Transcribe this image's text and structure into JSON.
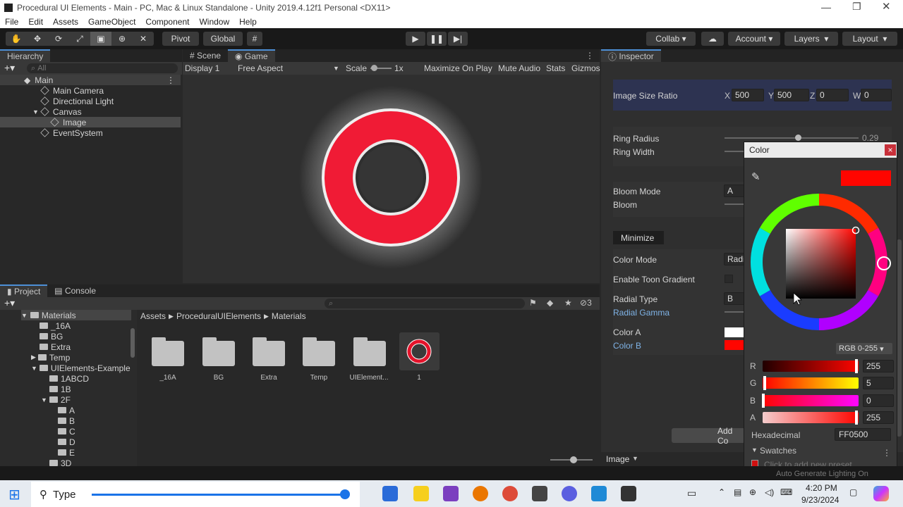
{
  "window": {
    "title": "Procedural UI Elements - Main - PC, Mac & Linux Standalone - Unity 2019.4.12f1 Personal <DX11>"
  },
  "menu": [
    "File",
    "Edit",
    "Assets",
    "GameObject",
    "Component",
    "Window",
    "Help"
  ],
  "toolbar": {
    "pivot": "Pivot",
    "global": "Global",
    "collab": "Collab",
    "account": "Account",
    "layers": "Layers",
    "layout": "Layout"
  },
  "hierarchy": {
    "tab": "Hierarchy",
    "search_placeholder": "All",
    "scene": "Main",
    "items": [
      "Main Camera",
      "Directional Light",
      "Canvas",
      "Image",
      "EventSystem"
    ]
  },
  "scene_tabs": {
    "scene": "Scene",
    "game": "Game"
  },
  "game_bar": {
    "display": "Display 1",
    "aspect": "Free Aspect",
    "scale_label": "Scale",
    "scale_value": "1x",
    "maximize": "Maximize On Play",
    "mute": "Mute Audio",
    "stats": "Stats",
    "gizmos": "Gizmos"
  },
  "project": {
    "tab": "Project",
    "console": "Console",
    "badge": "3",
    "tree": [
      "Materials",
      "_16A",
      "BG",
      "Extra",
      "Temp",
      "UIElements-Example",
      "1ABCD",
      "1B",
      "2F",
      "A",
      "B",
      "C",
      "D",
      "E",
      "3D"
    ],
    "breadcrumb": [
      "Assets",
      "ProceduralUIElements",
      "Materials"
    ],
    "assets": [
      "_16A",
      "BG",
      "Extra",
      "Temp",
      "UIElement...",
      "1"
    ]
  },
  "inspector": {
    "tab": "Inspector",
    "size_ratio_label": "Image Size Ratio",
    "size_x": "500",
    "size_y": "500",
    "size_z": "0",
    "size_w": "0",
    "ring_radius": "Ring Radius",
    "ring_radius_val": "0.29",
    "ring_width": "Ring Width",
    "bloom_mode": "Bloom Mode",
    "bloom_mode_val": "A",
    "bloom": "Bloom",
    "minimize": "Minimize",
    "color_mode": "Color Mode",
    "color_mode_val": "Radi",
    "toon": "Enable Toon Gradient",
    "radial_type": "Radial Type",
    "radial_type_val": "B",
    "radial_gamma": "Radial Gamma",
    "color_a": "Color A",
    "color_b": "Color B",
    "add_component": "Add Co",
    "footer": "Image"
  },
  "color_picker": {
    "title": "Color",
    "close": "×",
    "mode": "RGB 0-255",
    "r_label": "R",
    "r": "255",
    "g_label": "G",
    "g": "5",
    "b_label": "B",
    "b": "0",
    "a_label": "A",
    "a": "255",
    "hex_label": "Hexadecimal",
    "hex": "FF0500",
    "swatches": "Swatches",
    "swatch_hint": "Click to add new preset",
    "current_color": "#ff0500"
  },
  "taskbar": {
    "search": "Type",
    "time": "4:20 PM",
    "date": "9/23/2024",
    "status_text": "Auto Generate Lighting On"
  }
}
